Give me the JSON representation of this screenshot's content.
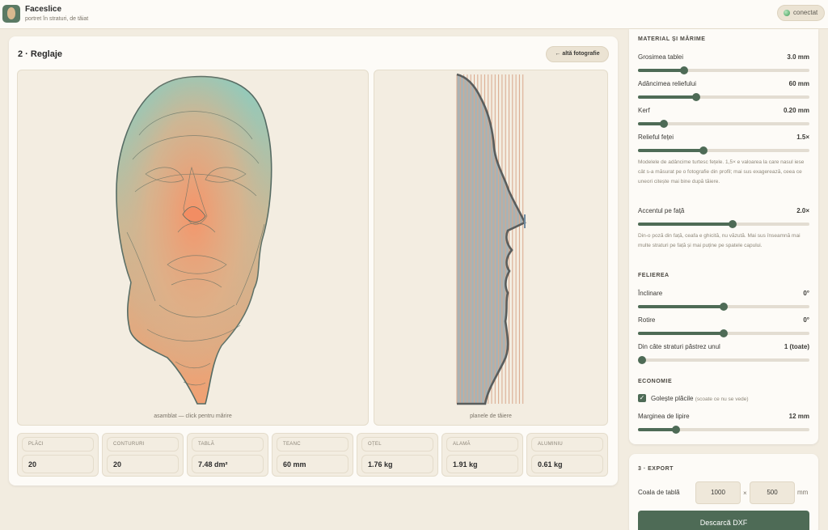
{
  "header": {
    "title": "Faceslice",
    "subtitle": "portret în straturi, de tăiat",
    "status": "conectat"
  },
  "main": {
    "title": "2 · Reglaje",
    "back_button": "← altă fotografie",
    "assembly_caption": "asamblat — click pentru mărire",
    "planes_caption": "planele de tăiere"
  },
  "stats": [
    {
      "label": "PLĂCI",
      "value": "20"
    },
    {
      "label": "CONTURURI",
      "value": "20"
    },
    {
      "label": "TABLĂ",
      "value": "7.48 dm²"
    },
    {
      "label": "TEANC",
      "value": "60 mm"
    },
    {
      "label": "OȚEL",
      "value": "1.76 kg"
    },
    {
      "label": "ALAMĂ",
      "value": "1.91 kg"
    },
    {
      "label": "ALUMINIU",
      "value": "0.61 kg"
    }
  ],
  "material": {
    "heading": "MATERIAL ȘI MĂRIME",
    "thickness": {
      "label": "Grosimea tablei",
      "value": "3.0 mm",
      "level": 0.27
    },
    "relief_depth": {
      "label": "Adâncimea reliefului",
      "value": "60 mm",
      "level": 0.34
    },
    "kerf": {
      "label": "Kerf",
      "value": "0.20 mm",
      "level": 0.15
    },
    "face_relief": {
      "label": "Relieful feței",
      "value": "1.5×",
      "level": 0.38
    },
    "face_relief_note": "Modelele de adâncime turtesc fețele. 1,5× e valoarea la care nasul iese cât s-a măsurat pe o fotografie din profil; mai sus exagerează, ceea ce uneori citește mai bine după tăiere.",
    "face_accent": {
      "label": "Accentul pe față",
      "value": "2.0×",
      "level": 0.55
    },
    "face_accent_note": "Din-o poză din față, ceafa e ghicită, nu văzută. Mai sus înseamnă mai multe straturi pe față și mai puține pe spatele capului."
  },
  "slicing": {
    "heading": "FELIEREA",
    "tilt": {
      "label": "Înclinare",
      "value": "0°",
      "level": 0.5
    },
    "rotation": {
      "label": "Rotire",
      "value": "0°",
      "level": 0.5
    },
    "keep_every": {
      "label": "Din câte straturi păstrez unul",
      "value": "1 (toate)",
      "level": 0.0
    }
  },
  "economy": {
    "heading": "ECONOMIE",
    "hollow_label": "Golește plăcile",
    "hollow_hint": "(scoate ce nu se vede)",
    "hollow_checked": true,
    "margin": {
      "label": "Marginea de lipire",
      "value": "12 mm",
      "level": 0.22
    }
  },
  "export": {
    "heading": "3 · EXPORT",
    "sheet_label": "Coala de tablă",
    "width": "1000",
    "times": "×",
    "height": "500",
    "unit": "mm",
    "button": "Descarcă DXF"
  },
  "colors": {
    "accent": "#4e6b56",
    "contour_top": "#8fcbbd",
    "contour_bottom": "#f2a070",
    "planes_line": "#d9a88c",
    "planes_fill": "#a8b3b5"
  }
}
